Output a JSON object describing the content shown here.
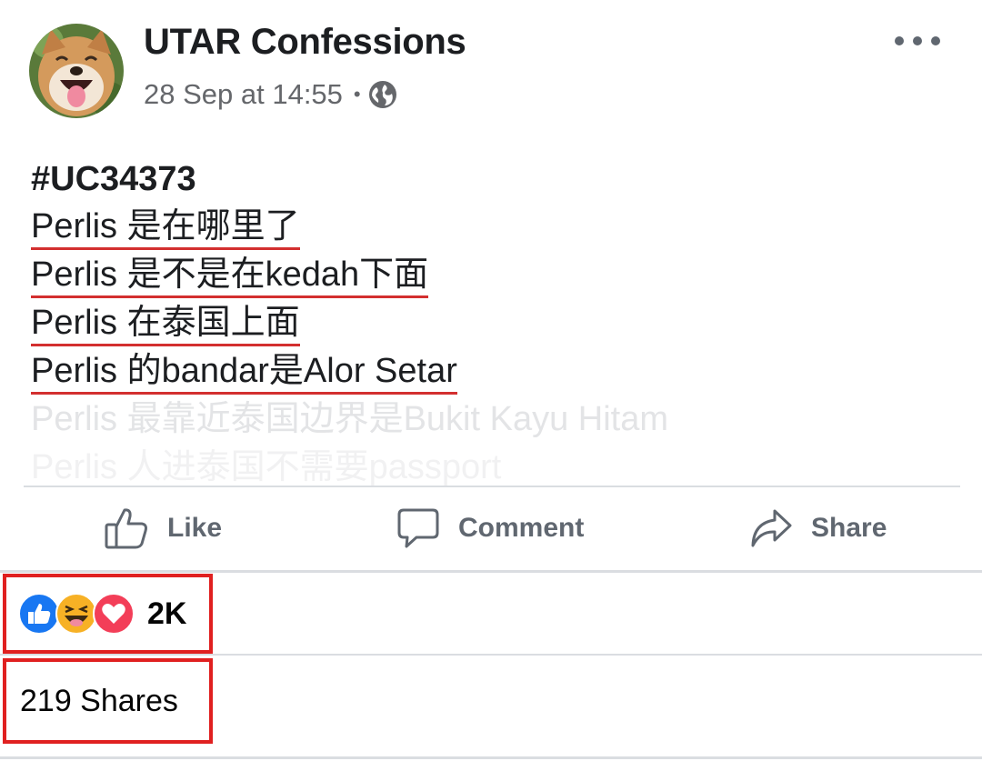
{
  "post": {
    "page_name": "UTAR Confessions",
    "timestamp": "28 Sep at 14:55",
    "separator": "•",
    "privacy_icon": "globe-icon",
    "more_icon": "more-options-icon",
    "hashtag": "#UC34373",
    "lines": [
      "Perlis 是在哪里了",
      "Perlis 是不是在kedah下面",
      "Perlis 在泰国上面",
      "Perlis 的bandar是Alor Setar",
      "Perlis 最靠近泰国边界是Bukit Kayu Hitam",
      "Perlis 人进泰国不需要passport"
    ]
  },
  "actions": {
    "like_label": "Like",
    "comment_label": "Comment",
    "share_label": "Share"
  },
  "stats": {
    "reaction_icons": [
      "like-reaction-icon",
      "haha-reaction-icon",
      "love-reaction-icon"
    ],
    "reactions_count": "2K",
    "shares_label": "219 Shares"
  },
  "colors": {
    "highlight_box": "#e02020",
    "underline": "#d32f2f",
    "like_blue": "#1877f2",
    "love_red": "#f33e58",
    "haha_yellow": "#f7b125",
    "secondary_text": "#65676b"
  }
}
